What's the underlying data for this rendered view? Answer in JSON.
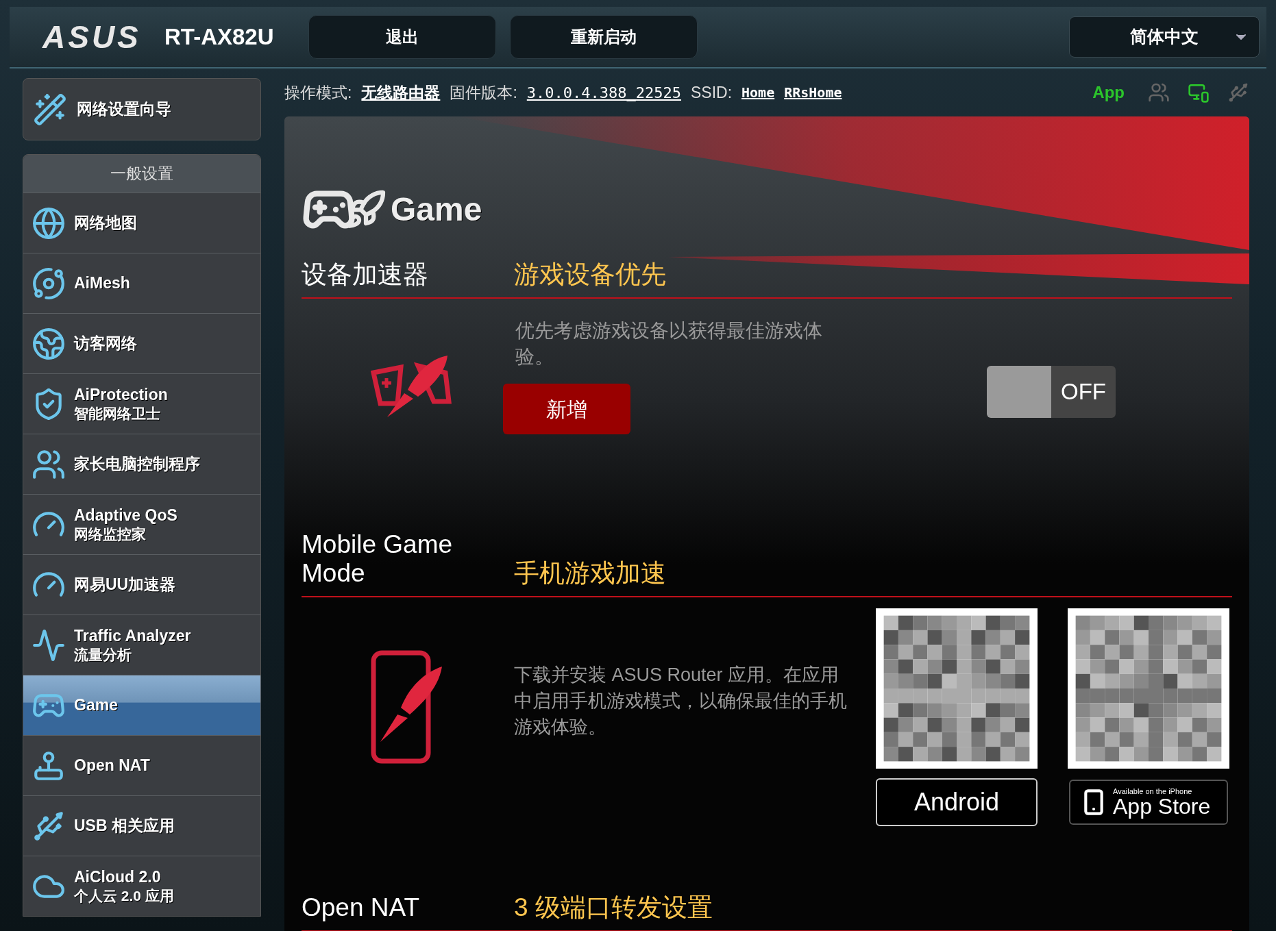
{
  "header": {
    "logo": "ASUS",
    "model": "RT-AX82U",
    "buttons": [
      "退出",
      "重新启动"
    ],
    "language": "简体中文"
  },
  "info_bar": {
    "mode_label": "操作模式:",
    "mode": "无线路由器",
    "firmware_label": "固件版本:",
    "firmware": "3.0.0.4.388_22525",
    "ssid_label": "SSID:",
    "ssids": [
      "Home",
      "RRsHome"
    ],
    "app": "App"
  },
  "sidebar": {
    "wizard": "网络设置向导",
    "section_title": "一般设置",
    "items": [
      {
        "title": "网络地图",
        "selected": false
      },
      {
        "title": "AiMesh",
        "selected": false
      },
      {
        "title": "访客网络",
        "selected": false
      },
      {
        "title": "AiProtection",
        "subtitle": "智能网络卫士",
        "selected": false
      },
      {
        "title": "家长电脑控制程序",
        "selected": false
      },
      {
        "title": "Adaptive QoS",
        "subtitle": "网络监控家",
        "selected": false
      },
      {
        "title": "网易UU加速器",
        "selected": false
      },
      {
        "title": "Traffic Analyzer",
        "subtitle": "流量分析",
        "selected": false
      },
      {
        "title": "Game",
        "selected": true
      },
      {
        "title": "Open NAT",
        "selected": false
      },
      {
        "title": "USB 相关应用",
        "selected": false
      },
      {
        "title": "AiCloud 2.0",
        "subtitle": "个人云 2.0 应用",
        "selected": false
      }
    ]
  },
  "page": {
    "title": "Game",
    "sections": [
      {
        "kind": "toggle",
        "label": "设备加速器",
        "heading": "游戏设备优先",
        "description": "优先考虑游戏设备以获得最佳游戏体验。",
        "button": "新增",
        "toggle": {
          "on": false,
          "label": "OFF"
        }
      },
      {
        "kind": "apps",
        "label": "Mobile Game Mode",
        "heading": "手机游戏加速",
        "description": "下载并安装 ASUS Router 应用。在应用中启用手机游戏模式，以确保最佳的手机游戏体验。",
        "android": "Android",
        "appstore_small": "Available on the iPhone",
        "appstore": "App Store"
      },
      {
        "kind": "heading",
        "label": "Open NAT",
        "heading": "3 级端口转发设置"
      }
    ]
  }
}
